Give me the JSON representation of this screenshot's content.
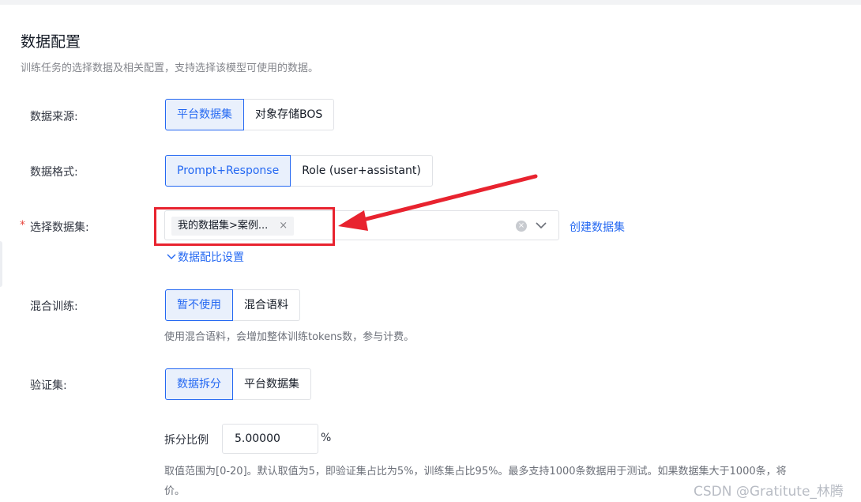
{
  "section": {
    "title": "数据配置",
    "subtitle": "训练任务的选择数据及相关配置，支持选择该模型可使用的数据。"
  },
  "source": {
    "label": "数据来源:",
    "options": [
      "平台数据集",
      "对象存储BOS"
    ],
    "selected": "平台数据集"
  },
  "format": {
    "label": "数据格式:",
    "options": [
      "Prompt+Response",
      "Role (user+assistant)"
    ],
    "selected": "Prompt+Response"
  },
  "dataset": {
    "required_mark": "*",
    "label": "选择数据集:",
    "tag": "我的数据集>案例...",
    "tag_close": "×",
    "clear": "×",
    "create_link": "创建数据集",
    "ratio_link": "数据配比设置"
  },
  "mix": {
    "label": "混合训练:",
    "options": [
      "暂不使用",
      "混合语料"
    ],
    "selected": "暂不使用",
    "hint": "使用混合语料，会增加整体训练tokens数，参与计费。"
  },
  "validation": {
    "label": "验证集:",
    "options": [
      "数据拆分",
      "平台数据集"
    ],
    "selected": "数据拆分",
    "ratio_label": "拆分比例",
    "ratio_value": "5.00000",
    "ratio_unit": "%",
    "hint_line1": "取值范围为[0-20]。默认取值为5，即验证集占比为5%，训练集占比95%。最多支持1000条数据用于测试。如果数据集大于1000条，将",
    "hint_line2": "价。"
  },
  "watermark": "CSDN @Gratitute_林腾",
  "colors": {
    "accent": "#2468f2",
    "annotation_red": "#e8232f",
    "required": "#e8473e"
  },
  "icons": [
    "clear-icon",
    "chevron-down-icon",
    "close-icon"
  ]
}
